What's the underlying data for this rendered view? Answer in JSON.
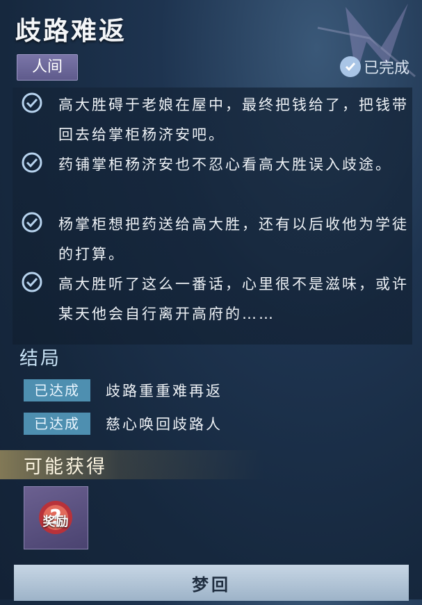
{
  "quest": {
    "title": "歧路难返",
    "tag": "人间",
    "status": "已完成"
  },
  "progress": [
    {
      "text": "高大胜碍于老娘在屋中，最终把钱给了，把钱带回去给掌柜杨济安吧。"
    },
    {
      "text": "药铺掌柜杨济安也不忍心看高大胜误入歧途。"
    },
    {
      "text": "杨掌柜想把药送给高大胜，还有以后收他为学徒的打算。"
    },
    {
      "text": "高大胜听了这么一番话，心里很不是滋味，或许某天他会自行离开高府的……"
    }
  ],
  "endings": {
    "title": "结局",
    "items": [
      {
        "badge": "已达成",
        "label": "歧路重重难再返"
      },
      {
        "badge": "已达成",
        "label": "慈心唤回歧路人"
      }
    ]
  },
  "rewards": {
    "title": "可能获得",
    "items": [
      {
        "label": "奖励",
        "icon": "mystery-reward-icon"
      }
    ]
  },
  "button": {
    "label": "梦回"
  },
  "colors": {
    "accent": "#4e8fb0",
    "tag": "#6b67a0",
    "check": "#a9c5e6"
  }
}
